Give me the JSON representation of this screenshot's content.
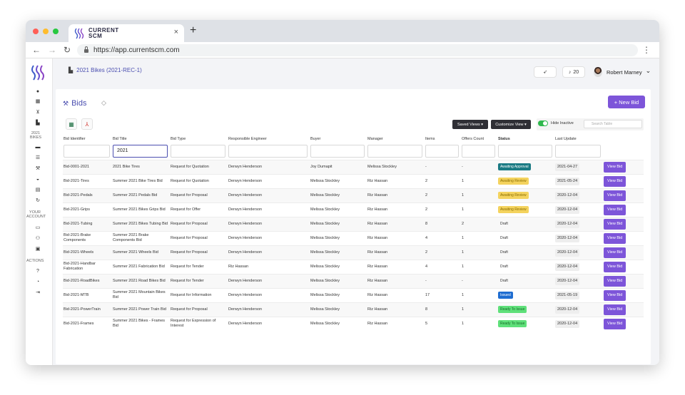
{
  "browser": {
    "tab_title_line1": "CURRENT",
    "tab_title_line2": "SCM",
    "tab_close": "×",
    "new_tab": "+",
    "back": "←",
    "forward": "→",
    "reload": "↻",
    "url": "https://app.currentscm.com",
    "menu": "⋮"
  },
  "topbar": {
    "breadcrumb": "2021 Bikes (2021-REC-1)",
    "notifications_count": "20",
    "user_name": "Robert Marney",
    "user_chevron": "⌄"
  },
  "sidebar": {
    "section_bikes": "2021 BIKES",
    "section_account": "YOUR ACCOUNT",
    "section_actions": "ACTIONS"
  },
  "page": {
    "title": "Bids",
    "new_bid_label": "+ New Bid",
    "saved_views_label": "Saved Views ▾",
    "customize_view_label": "Customize View ▾",
    "hide_inactive_label": "Hide Inactive",
    "search_placeholder": "Search Table"
  },
  "table": {
    "columns": [
      "Bid Identifier",
      "Bid Title",
      "Bid Type",
      "Responsible Engineer",
      "Buyer",
      "Manager",
      "Items",
      "Offers Count",
      "Status",
      "Last Update",
      ""
    ],
    "filters": [
      "",
      "2021",
      "",
      "",
      "",
      "",
      "",
      "",
      "",
      "",
      ""
    ],
    "view_label": "View Bid",
    "rows": [
      {
        "id": "Bid-0001-2021",
        "title": "2021 Bike Tires",
        "type": "Request for Quotation",
        "engineer": "Derwyn Henderson",
        "buyer": "Joy Dumapit",
        "manager": "Melissa Stockley",
        "items": "-",
        "offers": "-",
        "status": "Awaiting Approval",
        "status_class": "st-approval",
        "updated": "2021-04-27"
      },
      {
        "id": "Bid-2021-Tires",
        "title": "Summer 2021 Bike Tires Bid",
        "type": "Request for Quotation",
        "engineer": "Derwyn Henderson",
        "buyer": "Melissa Stockley",
        "manager": "Riz Hassan",
        "items": "2",
        "offers": "1",
        "status": "Awaiting Review",
        "status_class": "st-review",
        "updated": "2021-05-24"
      },
      {
        "id": "Bid-2021-Pedals",
        "title": "Summer 2021 Pedals Bid",
        "type": "Request for Proposal",
        "engineer": "Derwyn Henderson",
        "buyer": "Melissa Stockley",
        "manager": "Riz Hassan",
        "items": "2",
        "offers": "1",
        "status": "Awaiting Review",
        "status_class": "st-review",
        "updated": "2020-12-04"
      },
      {
        "id": "Bid-2021-Grips",
        "title": "Summer 2021 Bikes Grips Bid",
        "type": "Request for Offer",
        "engineer": "Derwyn Henderson",
        "buyer": "Melissa Stockley",
        "manager": "Riz Hassan",
        "items": "2",
        "offers": "1",
        "status": "Awaiting Review",
        "status_class": "st-review",
        "updated": "2020-12-04"
      },
      {
        "id": "Bid-2021-Tubing",
        "title": "Summer 2021 Bikes Tubing Bid",
        "type": "Request for Proposal",
        "engineer": "Derwyn Henderson",
        "buyer": "Melissa Stockley",
        "manager": "Riz Hassan",
        "items": "8",
        "offers": "2",
        "status": "Draft",
        "status_class": "st-draft",
        "updated": "2020-12-04"
      },
      {
        "id": "Bid-2021-Brake Components",
        "title": "Summer 2021 Brake Components Bid",
        "type": "Request for Proposal",
        "engineer": "Derwyn Henderson",
        "buyer": "Melissa Stockley",
        "manager": "Riz Hassan",
        "items": "4",
        "offers": "1",
        "status": "Draft",
        "status_class": "st-draft",
        "updated": "2020-12-04"
      },
      {
        "id": "Bid-2021-Wheels",
        "title": "Summer 2021 Wheels Bid",
        "type": "Request for Proposal",
        "engineer": "Derwyn Henderson",
        "buyer": "Melissa Stockley",
        "manager": "Riz Hassan",
        "items": "2",
        "offers": "1",
        "status": "Draft",
        "status_class": "st-draft",
        "updated": "2020-12-04"
      },
      {
        "id": "Bid-2021-Handbar Fabrication",
        "title": "Summer 2021 Fabrication Bid",
        "type": "Request for Tender",
        "engineer": "Riz Hassan",
        "buyer": "Melissa Stockley",
        "manager": "Riz Hassan",
        "items": "4",
        "offers": "1",
        "status": "Draft",
        "status_class": "st-draft",
        "updated": "2020-12-04"
      },
      {
        "id": "Bid-2021-RoadBikes",
        "title": "Summer 2021 Road Bikes Bid",
        "type": "Request for Tender",
        "engineer": "Derwyn Henderson",
        "buyer": "Melissa Stockley",
        "manager": "Riz Hassan",
        "items": "-",
        "offers": "-",
        "status": "Draft",
        "status_class": "st-draft",
        "updated": "2020-12-04"
      },
      {
        "id": "Bid-2021-MTB",
        "title": "Summer 2021 Mountain Bikes Bid",
        "type": "Request for Information",
        "engineer": "Derwyn Henderson",
        "buyer": "Melissa Stockley",
        "manager": "Riz Hassan",
        "items": "17",
        "offers": "1",
        "status": "Issued",
        "status_class": "st-issued",
        "updated": "2021-05-19"
      },
      {
        "id": "Bid-2021-PowerTrain",
        "title": "Summer 2021 Power Train Bid",
        "type": "Request for Proposal",
        "engineer": "Derwyn Henderson",
        "buyer": "Melissa Stockley",
        "manager": "Riz Hassan",
        "items": "8",
        "offers": "1",
        "status": "Ready To Issue",
        "status_class": "st-ready",
        "updated": "2020-12-04"
      },
      {
        "id": "Bid-2021-Frames",
        "title": "Summer 2021 Bikes - Frames Bid",
        "type": "Request for Expression of Interest",
        "engineer": "Derwyn Henderson",
        "buyer": "Melissa Stockley",
        "manager": "Riz Hassan",
        "items": "5",
        "offers": "1",
        "status": "Ready To Issue",
        "status_class": "st-ready",
        "updated": "2020-12-04"
      }
    ]
  },
  "colors": {
    "accent": "#7d55d9",
    "link": "#4b4fb0",
    "status_approval": "#1a7a83",
    "status_review": "#f4d35e",
    "status_issued": "#1f6dd1",
    "status_ready": "#5fe07a"
  },
  "icons": {
    "sidebar": [
      "user-icon",
      "building-icon",
      "cart-icon",
      "factory-icon",
      "folder-icon",
      "list-icon",
      "gavel-icon",
      "basket-icon",
      "document-icon",
      "sync-icon",
      "id-card-icon",
      "users-icon",
      "briefcase-icon",
      "help-icon",
      "support-icon",
      "logout-icon"
    ]
  }
}
